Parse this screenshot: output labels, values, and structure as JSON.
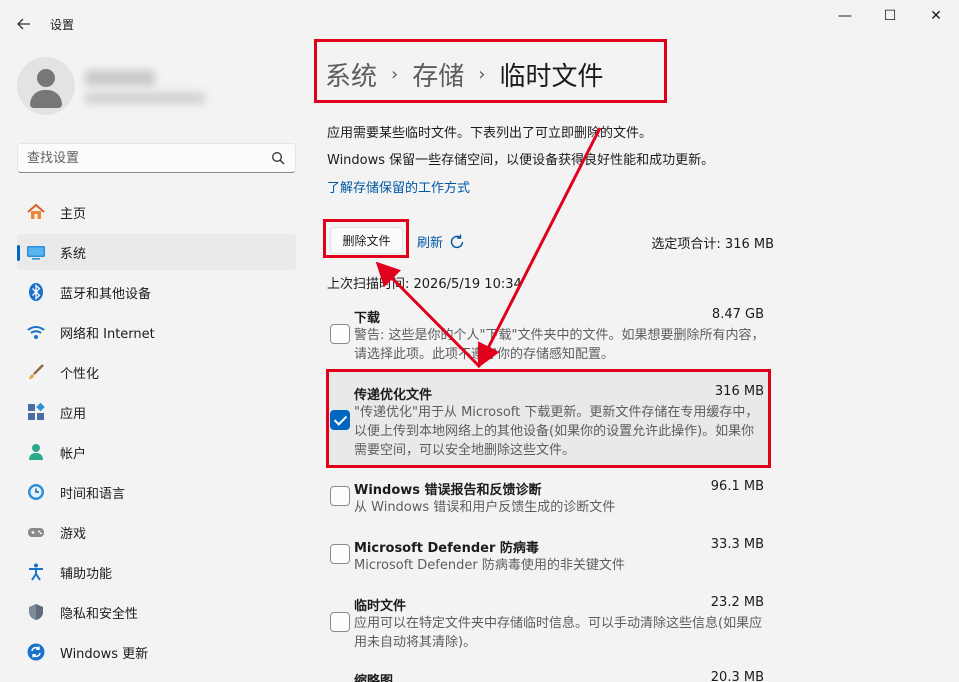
{
  "window": {
    "title": "设置",
    "back_icon": "back-arrow-icon",
    "minimize_glyph": "—",
    "maximize_glyph": "☐",
    "close_glyph": "✕"
  },
  "search": {
    "placeholder": "查找设置"
  },
  "sidebar": {
    "items": [
      {
        "label": "主页",
        "icon": "home-icon"
      },
      {
        "label": "系统",
        "icon": "system-icon",
        "active": true
      },
      {
        "label": "蓝牙和其他设备",
        "icon": "bluetooth-icon"
      },
      {
        "label": "网络和 Internet",
        "icon": "wifi-icon"
      },
      {
        "label": "个性化",
        "icon": "brush-icon"
      },
      {
        "label": "应用",
        "icon": "apps-icon"
      },
      {
        "label": "帐户",
        "icon": "account-icon"
      },
      {
        "label": "时间和语言",
        "icon": "clock-globe-icon"
      },
      {
        "label": "游戏",
        "icon": "gamepad-icon"
      },
      {
        "label": "辅助功能",
        "icon": "accessibility-icon"
      },
      {
        "label": "隐私和安全性",
        "icon": "shield-icon"
      },
      {
        "label": "Windows 更新",
        "icon": "update-icon"
      }
    ]
  },
  "main": {
    "breadcrumb": {
      "part1": "系统",
      "part2": "存储",
      "current": "临时文件",
      "separator": "›"
    },
    "desc1": "应用需要某些临时文件。下表列出了可立即删除的文件。",
    "desc2": "Windows 保留一些存储空间，以便设备获得良好性能和成功更新。",
    "learn_link": "了解存储保留的工作方式",
    "delete_button": "删除文件",
    "refresh_label": "刷新",
    "total_label": "选定项合计: 316 MB",
    "last_scan": "上次扫描时间: 2026/5/19 10:34",
    "files": [
      {
        "name": "下载",
        "size": "8.47 GB",
        "checked": false,
        "desc": "警告: 这些是你的个人\"下载\"文件夹中的文件。如果想要删除所有内容，请选择此项。此项不遵守你的存储感知配置。"
      },
      {
        "name": "传递优化文件",
        "size": "316 MB",
        "checked": true,
        "desc": "\"传递优化\"用于从 Microsoft 下载更新。更新文件存储在专用缓存中，以便上传到本地网络上的其他设备(如果你的设置允许此操作)。如果你需要空间，可以安全地删除这些文件。"
      },
      {
        "name": "Windows 错误报告和反馈诊断",
        "size": "96.1 MB",
        "checked": false,
        "desc": "从 Windows 错误和用户反馈生成的诊断文件"
      },
      {
        "name": "Microsoft Defender 防病毒",
        "size": "33.3 MB",
        "checked": false,
        "desc": "Microsoft Defender 防病毒使用的非关键文件"
      },
      {
        "name": "临时文件",
        "size": "23.2 MB",
        "checked": false,
        "desc": "应用可以在特定文件夹中存储临时信息。可以手动清除这些信息(如果应用未自动将其清除)。"
      },
      {
        "name": "缩略图",
        "size": "20.3 MB",
        "checked": false,
        "desc": ""
      }
    ]
  },
  "colors": {
    "accent": "#0067c0",
    "highlight": "#e0001b",
    "link": "#0057a3"
  }
}
